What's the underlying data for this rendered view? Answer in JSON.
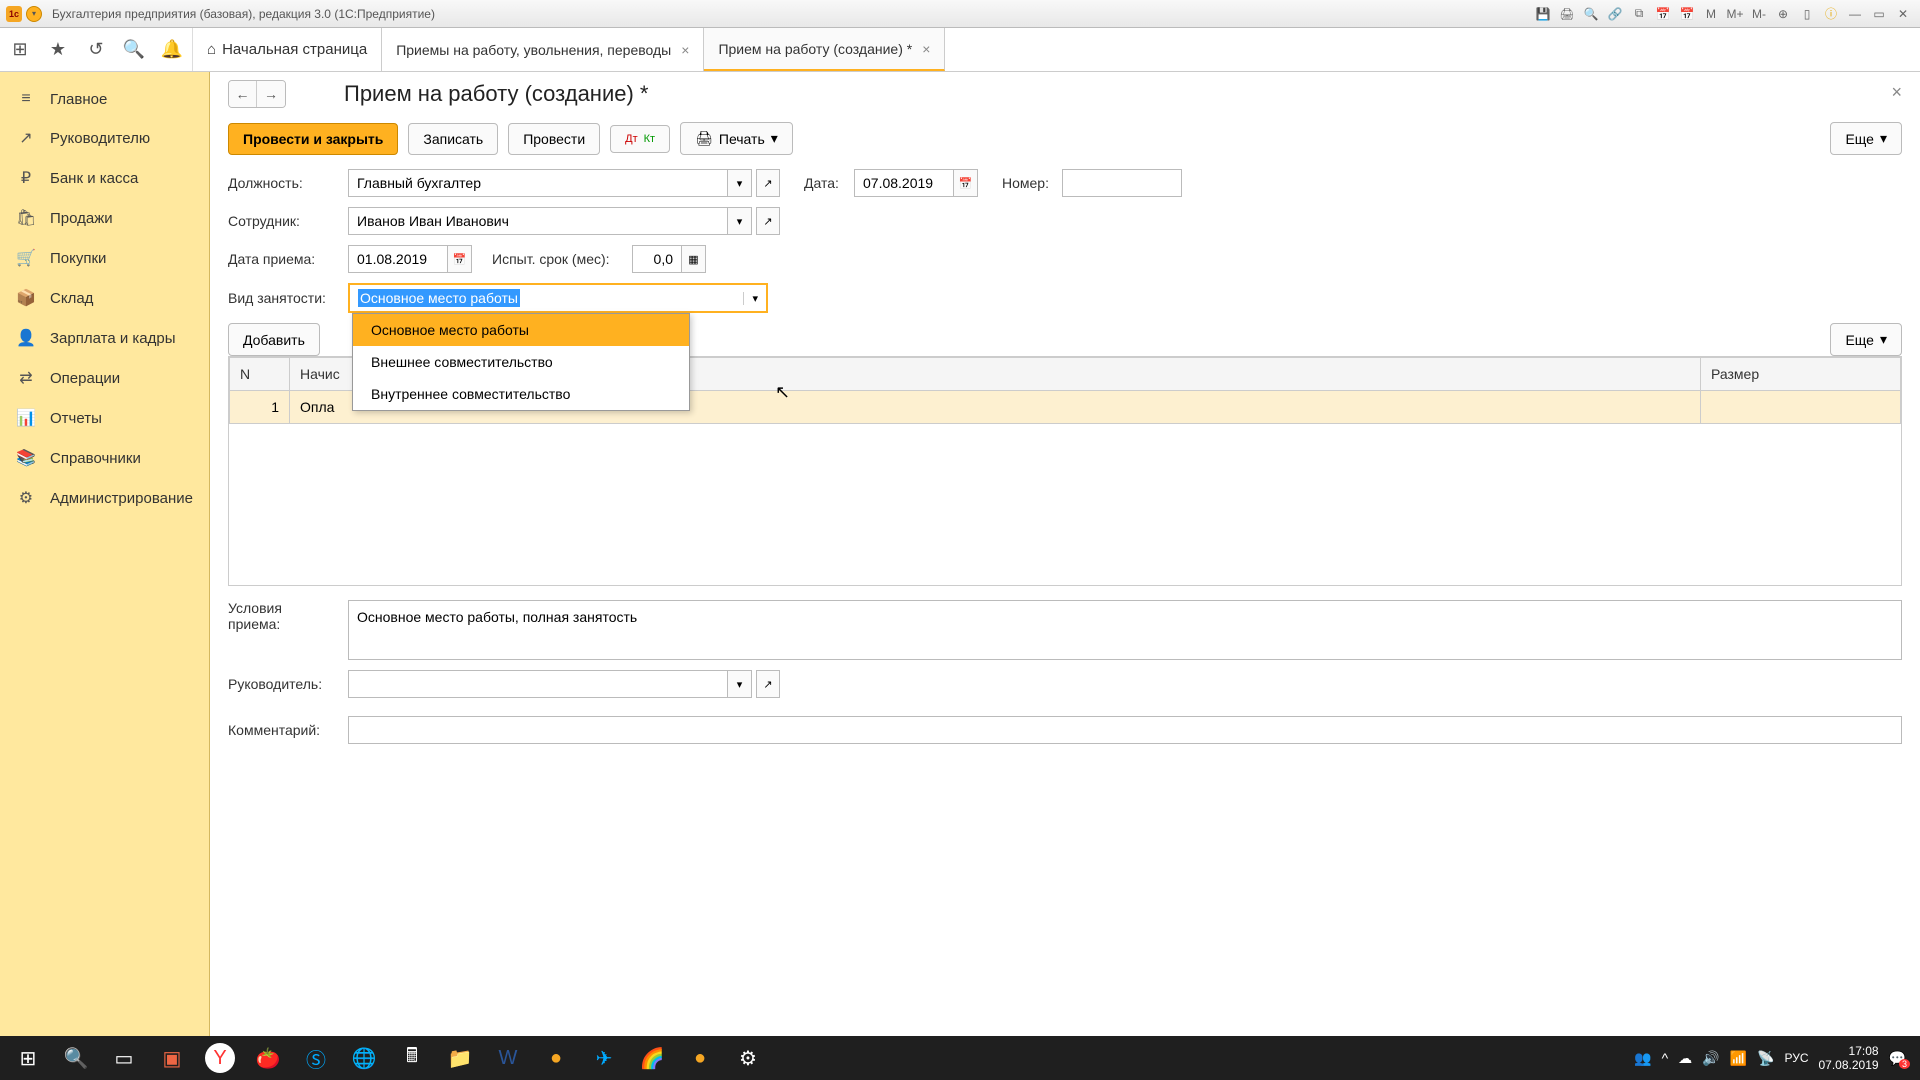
{
  "titlebar": {
    "app_badge": "1c",
    "title": "Бухгалтерия предприятия (базовая), редакция 3.0  (1С:Предприятие)"
  },
  "tabs": {
    "home": "Начальная страница",
    "tab1": "Приемы на работу, увольнения, переводы",
    "tab2": "Прием на работу (создание) *"
  },
  "sidebar": [
    {
      "icon": "≡",
      "label": "Главное"
    },
    {
      "icon": "↗",
      "label": "Руководителю"
    },
    {
      "icon": "₽",
      "label": "Банк и касса"
    },
    {
      "icon": "🛍",
      "label": "Продажи"
    },
    {
      "icon": "🛒",
      "label": "Покупки"
    },
    {
      "icon": "📦",
      "label": "Склад"
    },
    {
      "icon": "👤",
      "label": "Зарплата и кадры"
    },
    {
      "icon": "⇄",
      "label": "Операции"
    },
    {
      "icon": "📊",
      "label": "Отчеты"
    },
    {
      "icon": "📚",
      "label": "Справочники"
    },
    {
      "icon": "⚙",
      "label": "Администрирование"
    }
  ],
  "page": {
    "title": "Прием на работу (создание) *",
    "actions": {
      "submit_close": "Провести и закрыть",
      "save": "Записать",
      "submit": "Провести",
      "dtkt": "Дт/Кт",
      "print": "Печать",
      "more": "Еще"
    },
    "fields": {
      "position_label": "Должность:",
      "position_value": "Главный бухгалтер",
      "date_label": "Дата:",
      "date_value": "07.08.2019",
      "number_label": "Номер:",
      "number_value": "",
      "employee_label": "Сотрудник:",
      "employee_value": "Иванов Иван Иванович",
      "hire_date_label": "Дата приема:",
      "hire_date_value": "01.08.2019",
      "probation_label": "Испыт. срок (мес):",
      "probation_value": "0,0",
      "employment_type_label": "Вид занятости:",
      "employment_type_value": "Основное место работы",
      "employment_options": [
        "Основное место работы",
        "Внешнее совместительство",
        "Внутреннее совместительство"
      ],
      "conditions_label": "Условия приема:",
      "conditions_value": "Основное место работы, полная занятость",
      "manager_label": "Руководитель:",
      "manager_value": "",
      "comment_label": "Комментарий:",
      "comment_value": ""
    },
    "table": {
      "add": "Добавить",
      "headers": {
        "n": "N",
        "accrual": "Начис",
        "size": "Размер"
      },
      "row1": {
        "n": "1",
        "accrual": "Опла"
      }
    }
  },
  "taskbar": {
    "lang": "РУС",
    "time": "17:08",
    "date": "07.08.2019",
    "badge": "3"
  }
}
